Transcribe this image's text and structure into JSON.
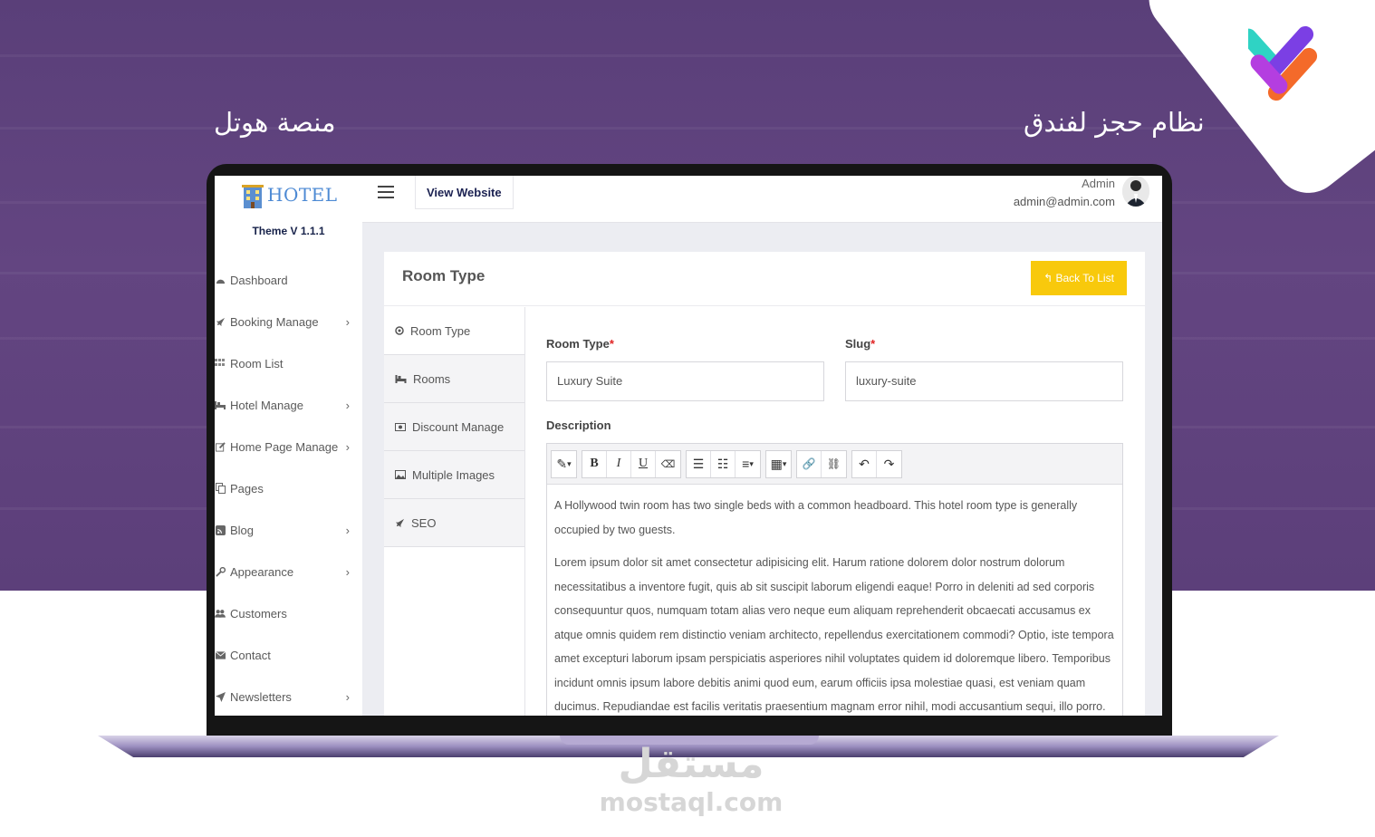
{
  "hero": {
    "title_left": "منصة هوتل",
    "title_right": "نظام حجز لفندق"
  },
  "watermark": {
    "ar": "مستقل",
    "en": "mostaql.com"
  },
  "app": {
    "brand": {
      "name": "HOTEL",
      "theme_version": "Theme V 1.1.1"
    },
    "sidebar": {
      "items": [
        {
          "label": "Dashboard",
          "icon": "dashboard-icon",
          "has_submenu": false
        },
        {
          "label": "Booking Manage",
          "icon": "rocket-icon",
          "has_submenu": true
        },
        {
          "label": "Room List",
          "icon": "grid-icon",
          "has_submenu": false
        },
        {
          "label": "Hotel Manage",
          "icon": "bed-icon",
          "has_submenu": true
        },
        {
          "label": "Home Page Manage",
          "icon": "edit-icon",
          "has_submenu": true
        },
        {
          "label": "Pages",
          "icon": "pages-icon",
          "has_submenu": false
        },
        {
          "label": "Blog",
          "icon": "rss-icon",
          "has_submenu": true
        },
        {
          "label": "Appearance",
          "icon": "wrench-icon",
          "has_submenu": true
        },
        {
          "label": "Customers",
          "icon": "users-icon",
          "has_submenu": false
        },
        {
          "label": "Contact",
          "icon": "envelope-icon",
          "has_submenu": false
        },
        {
          "label": "Newsletters",
          "icon": "send-icon",
          "has_submenu": true
        }
      ],
      "chevron": "›"
    },
    "topbar": {
      "view_website": "View Website",
      "user_name": "Admin",
      "user_email": "admin@admin.com"
    },
    "card": {
      "title": "Room Type",
      "back_button": "Back To List"
    },
    "tabs": [
      {
        "label": "Room Type",
        "icon": "circle-icon"
      },
      {
        "label": "Rooms",
        "icon": "bed-icon"
      },
      {
        "label": "Discount Manage",
        "icon": "money-icon"
      },
      {
        "label": "Multiple Images",
        "icon": "image-icon"
      },
      {
        "label": "SEO",
        "icon": "rocket-icon"
      }
    ],
    "form": {
      "room_type_label": "Room Type",
      "room_type_value": "Luxury Suite",
      "slug_label": "Slug",
      "slug_value": "luxury-suite",
      "required_mark": "*",
      "description_label": "Description",
      "description_paragraphs": [
        "A Hollywood twin room has two single beds with a common headboard. This hotel room type is generally occupied by two guests.",
        "Lorem ipsum dolor sit amet consectetur adipisicing elit. Harum ratione dolorem dolor nostrum dolorum necessitatibus a inventore fugit, quis ab sit suscipit laborum eligendi eaque! Porro in deleniti ad sed corporis consequuntur quos, numquam totam alias vero neque eum aliquam reprehenderit obcaecati accusamus ex atque omnis quidem rem distinctio veniam architecto, repellendus exercitationem commodi? Optio, iste tempora amet excepturi laborum ipsam perspiciatis asperiores nihil voluptates quidem id doloremque libero. Temporibus incidunt omnis ipsum labore debitis animi quod eum, earum officiis ipsa molestiae quasi, est veniam quam ducimus. Repudiandae est facilis veritatis praesentium magnam error nihil, modi accusantium sequi, illo porro."
      ]
    },
    "toolbar": {
      "style": "✎",
      "bold": "B",
      "italic": "I",
      "underline": "U",
      "eraser": "⌫",
      "ul": "☰",
      "ol": "☷",
      "align": "≡",
      "table": "▦",
      "link": "🔗",
      "unlink": "⛓",
      "undo": "↶",
      "redo": "↷",
      "caret": "▾"
    }
  },
  "colors": {
    "hero": "#5c4080",
    "accent_yellow": "#f8c90c",
    "navy": "#1b2151",
    "brand_blue": "#4d8ad4",
    "required": "#e02424"
  }
}
